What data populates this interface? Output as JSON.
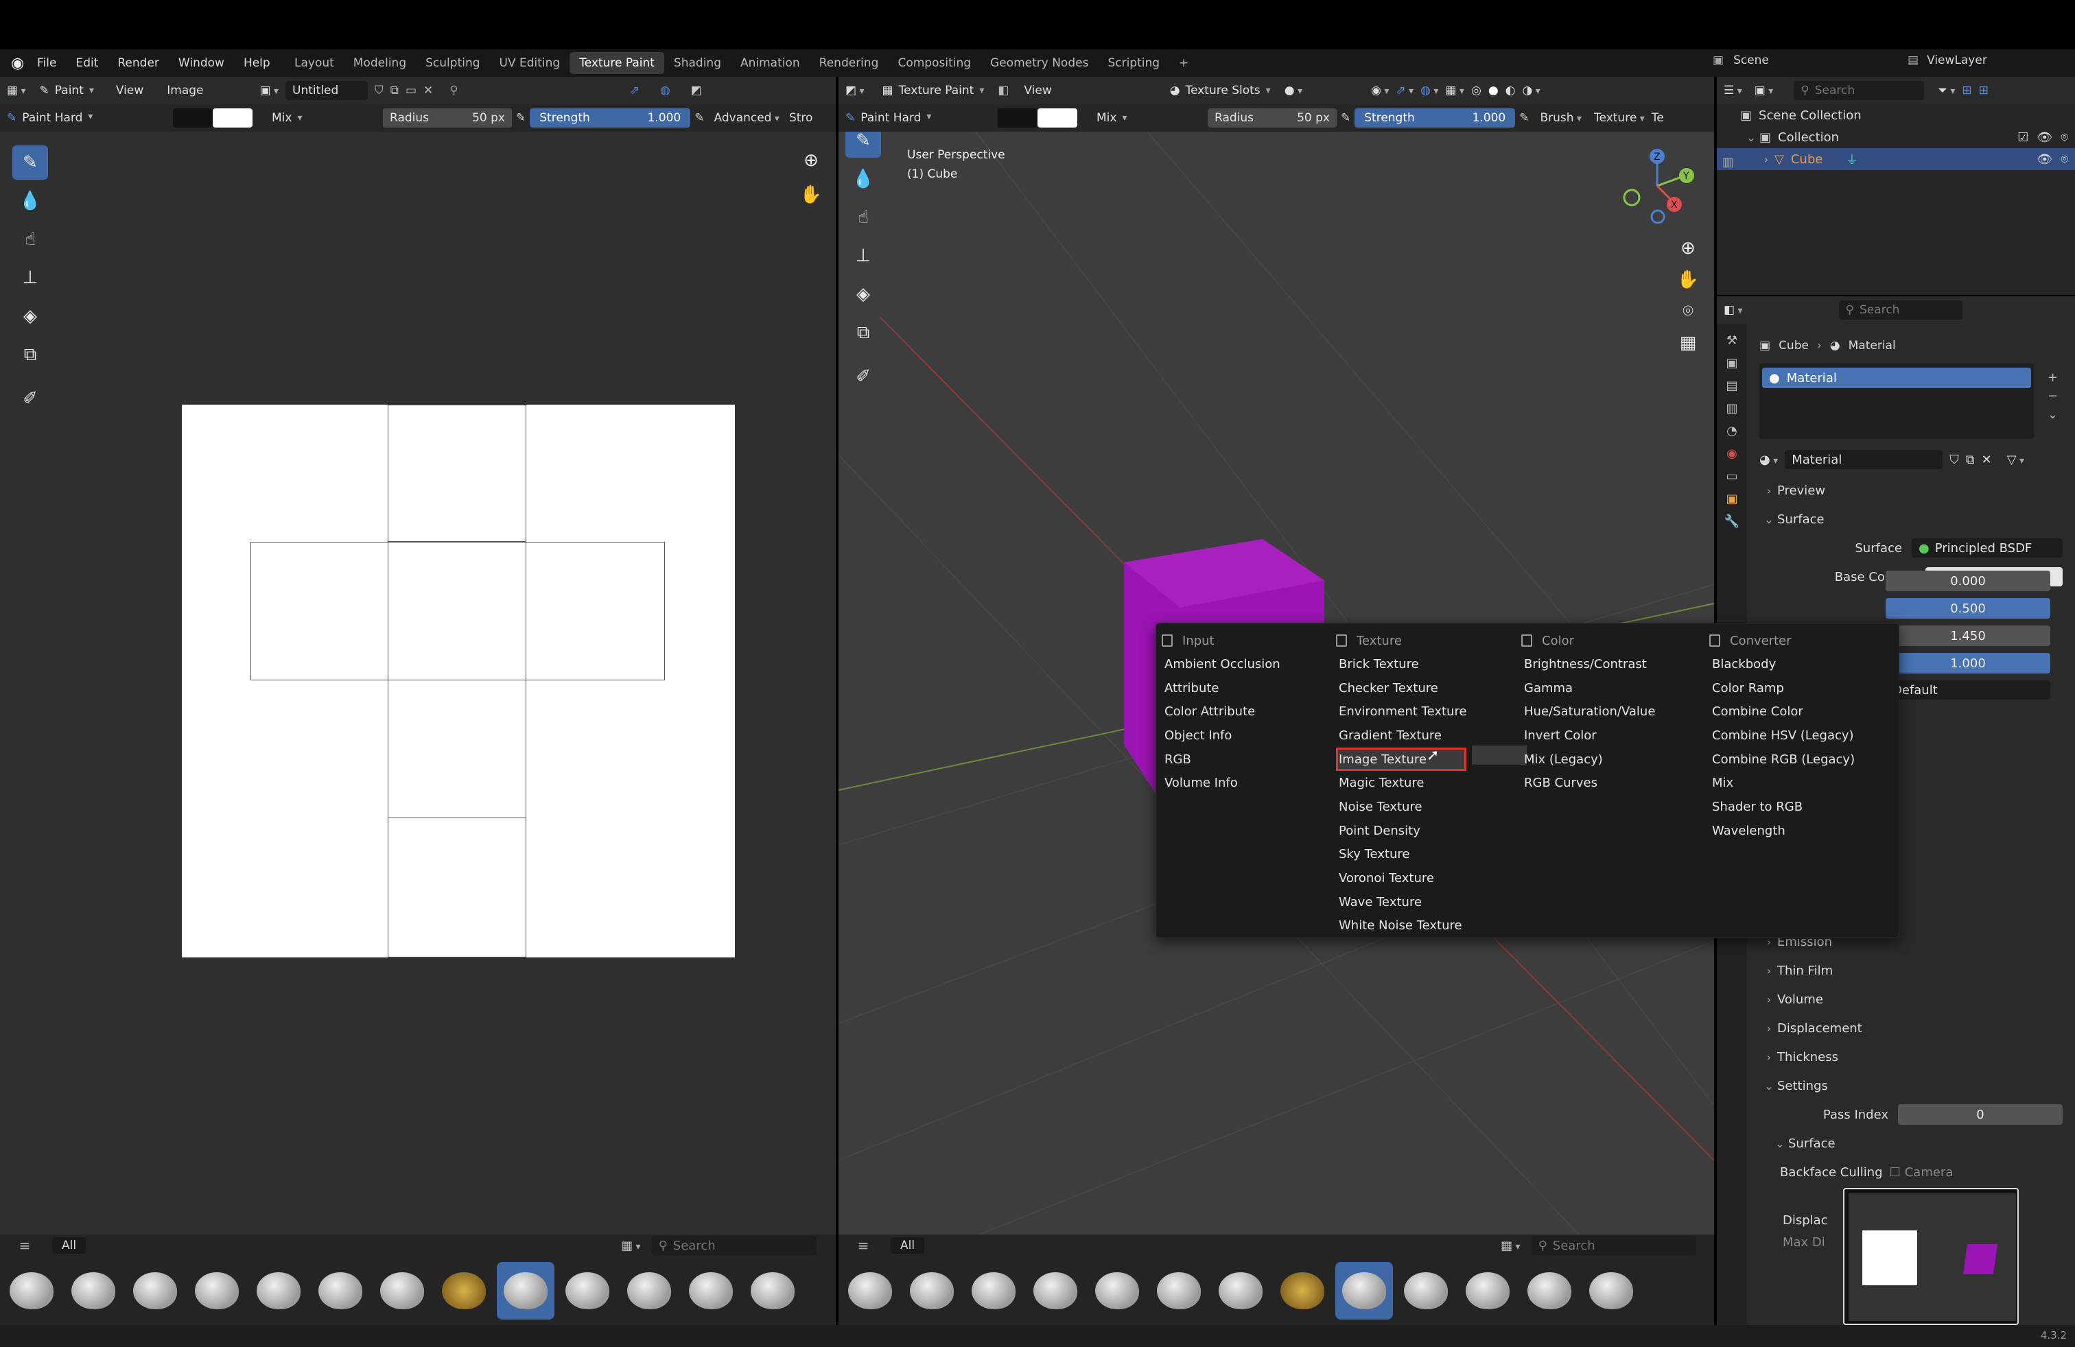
{
  "menu": {
    "items": [
      "File",
      "Edit",
      "Render",
      "Window",
      "Help"
    ]
  },
  "workspaces": {
    "tabs": [
      "Layout",
      "Modeling",
      "Sculpting",
      "UV Editing",
      "Texture Paint",
      "Shading",
      "Animation",
      "Rendering",
      "Compositing",
      "Geometry Nodes",
      "Scripting"
    ],
    "active": "Texture Paint",
    "add": "+"
  },
  "scene": {
    "label": "Scene",
    "view_layer": "ViewLayer"
  },
  "image_editor": {
    "mode": "Paint",
    "view": "View",
    "image_menu": "Image",
    "image_name": "Untitled",
    "brush": "Paint Hard",
    "blend": "Mix",
    "radius_label": "Radius",
    "radius_value": "50 px",
    "strength_label": "Strength",
    "strength_value": "1.000",
    "advanced": "Advanced",
    "trunc": "Stro",
    "fg_color": "#111111",
    "bg_color": "#ffffff"
  },
  "viewport": {
    "mode": "Texture Paint",
    "view": "View",
    "slots": "Texture Slots",
    "brush": "Paint Hard",
    "blend": "Mix",
    "radius_label": "Radius",
    "radius_value": "50 px",
    "strength_label": "Strength",
    "strength_value": "1.000",
    "brush_menu": "Brush",
    "texture_menu": "Texture",
    "trunc": "Te",
    "perspective": "User Perspective",
    "object": "(1) Cube",
    "cube_color": "#9b14b4",
    "gizmo": {
      "z": "Z",
      "y": "Y",
      "x": "X"
    }
  },
  "add_menu": {
    "columns": [
      {
        "title": "Input",
        "items": [
          "Ambient Occlusion",
          "Attribute",
          "Color Attribute",
          "Object Info",
          "RGB",
          "Volume Info"
        ]
      },
      {
        "title": "Texture",
        "items": [
          "Brick Texture",
          "Checker Texture",
          "Environment Texture",
          "Gradient Texture",
          "Image Texture",
          "Magic Texture",
          "Noise Texture",
          "Point Density",
          "Sky Texture",
          "Voronoi Texture",
          "Wave Texture",
          "White Noise Texture"
        ]
      },
      {
        "title": "Color",
        "items": [
          "Brightness/Contrast",
          "Gamma",
          "Hue/Saturation/Value",
          "Invert Color",
          "Mix (Legacy)",
          "RGB Curves"
        ]
      },
      {
        "title": "Converter",
        "items": [
          "Blackbody",
          "Color Ramp",
          "Combine Color",
          "Combine HSV (Legacy)",
          "Combine RGB (Legacy)",
          "Mix",
          "Shader to RGB",
          "Wavelength"
        ]
      }
    ],
    "highlighted": "Image Texture"
  },
  "outliner": {
    "search_placeholder": "Search",
    "scene_collection": "Scene Collection",
    "collection": "Collection",
    "object": "Cube"
  },
  "properties": {
    "search_placeholder": "Search",
    "breadcrumb": {
      "object": "Cube",
      "material": "Material"
    },
    "slot": "Material",
    "material_name": "Material",
    "sections": {
      "preview": "Preview",
      "surface": "Surface"
    },
    "surface_label": "Surface",
    "surface_value": "Principled BSDF",
    "base_color_label": "Base Color",
    "values": [
      "0.000",
      "0.500",
      "1.450",
      "1.000"
    ],
    "default_label": "Default",
    "collapsed": [
      "Emission",
      "Thin Film",
      "Volume",
      "Displacement",
      "Thickness"
    ],
    "settings": "Settings",
    "pass_index_label": "Pass Index",
    "pass_index_value": "0",
    "sub_surface": "Surface",
    "backface_label": "Backface Culling",
    "backface_value": "Camera",
    "displace_label": "Displac",
    "maxdist_label": "Max Di"
  },
  "asset_shelf": {
    "filter": "All",
    "search_placeholder": "Search"
  },
  "status": {
    "version": "4.3.2"
  }
}
